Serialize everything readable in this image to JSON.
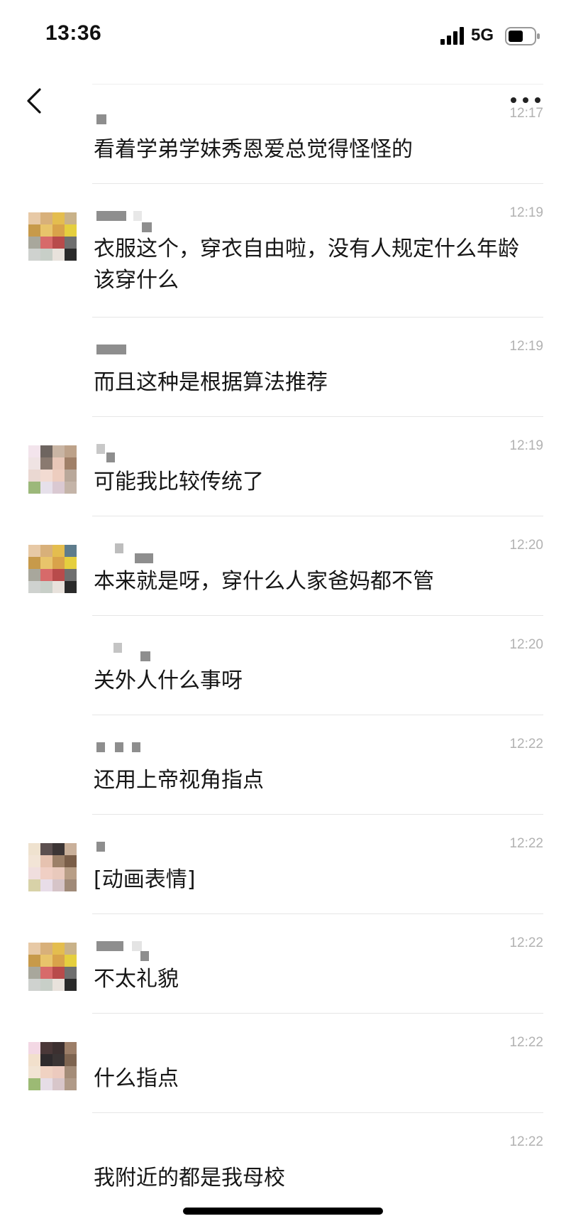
{
  "status_bar": {
    "time": "13:36",
    "network": "5G"
  },
  "messages": [
    {
      "time": "12:17",
      "text": "看着学弟学妹秀恩爱总觉得怪怪的",
      "has_avatar": false
    },
    {
      "time": "12:19",
      "text": "衣服这个，穿衣自由啦，没有人规定什么年龄该穿什么",
      "has_avatar": true
    },
    {
      "time": "12:19",
      "text": "而且这种是根据算法推荐",
      "has_avatar": false
    },
    {
      "time": "12:19",
      "text": "可能我比较传统了",
      "has_avatar": true
    },
    {
      "time": "12:20",
      "text": "本来就是呀，穿什么人家爸妈都不管",
      "has_avatar": true
    },
    {
      "time": "12:20",
      "text": "关外人什么事呀",
      "has_avatar": false
    },
    {
      "time": "12:22",
      "text": "还用上帝视角指点",
      "has_avatar": false
    },
    {
      "time": "12:22",
      "text": "[动画表情]",
      "has_avatar": true
    },
    {
      "time": "12:22",
      "text": "不太礼貌",
      "has_avatar": true
    },
    {
      "time": "12:22",
      "text": "什么指点",
      "has_avatar": true
    },
    {
      "time": "12:22",
      "text": "我附近的都是我母校",
      "has_avatar": false
    }
  ]
}
